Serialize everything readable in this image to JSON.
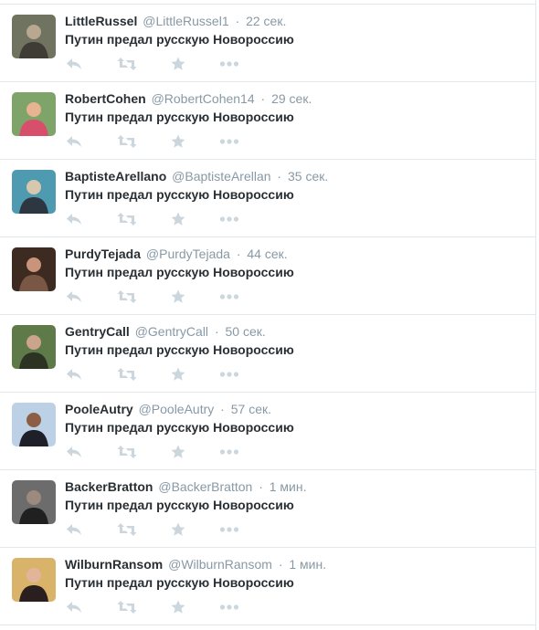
{
  "tweets": [
    {
      "fullname": "LittleRussel",
      "username": "@LittleRussel1",
      "separator": "·",
      "time": "22 сек.",
      "text": "Путин предал русскую Новороссию",
      "avatar_colors": [
        "#6f7360",
        "#3f3b35",
        "#b9a78f"
      ]
    },
    {
      "fullname": "RobertCohen",
      "username": "@RobertCohen14",
      "separator": "·",
      "time": "29 сек.",
      "text": "Путин предал русскую Новороссию",
      "avatar_colors": [
        "#7fa46a",
        "#d84f6c",
        "#e8b391"
      ]
    },
    {
      "fullname": "BaptisteArellano",
      "username": "@BaptisteArellan",
      "separator": "·",
      "time": "35 сек.",
      "text": "Путин предал русскую Новороссию",
      "avatar_colors": [
        "#4e9bb1",
        "#2d3742",
        "#d7c7ad"
      ]
    },
    {
      "fullname": "PurdyTejada",
      "username": "@PurdyTejada",
      "separator": "·",
      "time": "44 сек.",
      "text": "Путин предал русскую Новороссию",
      "avatar_colors": [
        "#3d2a20",
        "#7a5745",
        "#c8957c"
      ]
    },
    {
      "fullname": "GentryCall",
      "username": "@GentryCall",
      "separator": "·",
      "time": "50 сек.",
      "text": "Путин предал русскую Новороссию",
      "avatar_colors": [
        "#5e7a49",
        "#2c3322",
        "#caa48d"
      ]
    },
    {
      "fullname": "PooleAutry",
      "username": "@PooleAutry",
      "separator": "·",
      "time": "57 сек.",
      "text": "Путин предал русскую Новороссию",
      "avatar_colors": [
        "#bdd1e6",
        "#1f1f2a",
        "#8d5e45"
      ]
    },
    {
      "fullname": "BackerBratton",
      "username": "@BackerBratton",
      "separator": "·",
      "time": "1 мин.",
      "text": "Путин предал русскую Новороссию",
      "avatar_colors": [
        "#6c6c6c",
        "#202020",
        "#9c8a7f"
      ]
    },
    {
      "fullname": "WilburnRansom",
      "username": "@WilburnRansom",
      "separator": "·",
      "time": "1 мин.",
      "text": "Путин предал русскую Новороссию",
      "avatar_colors": [
        "#d9b36a",
        "#2a1f1e",
        "#e2b59a"
      ]
    }
  ],
  "action_icons": [
    "reply-icon",
    "retweet-icon",
    "favorite-icon",
    "more-icon"
  ],
  "colors": {
    "action_icon": "#ccd6dd",
    "text": "#292f33",
    "meta": "#8899a6",
    "divider": "#e1e8ed"
  }
}
